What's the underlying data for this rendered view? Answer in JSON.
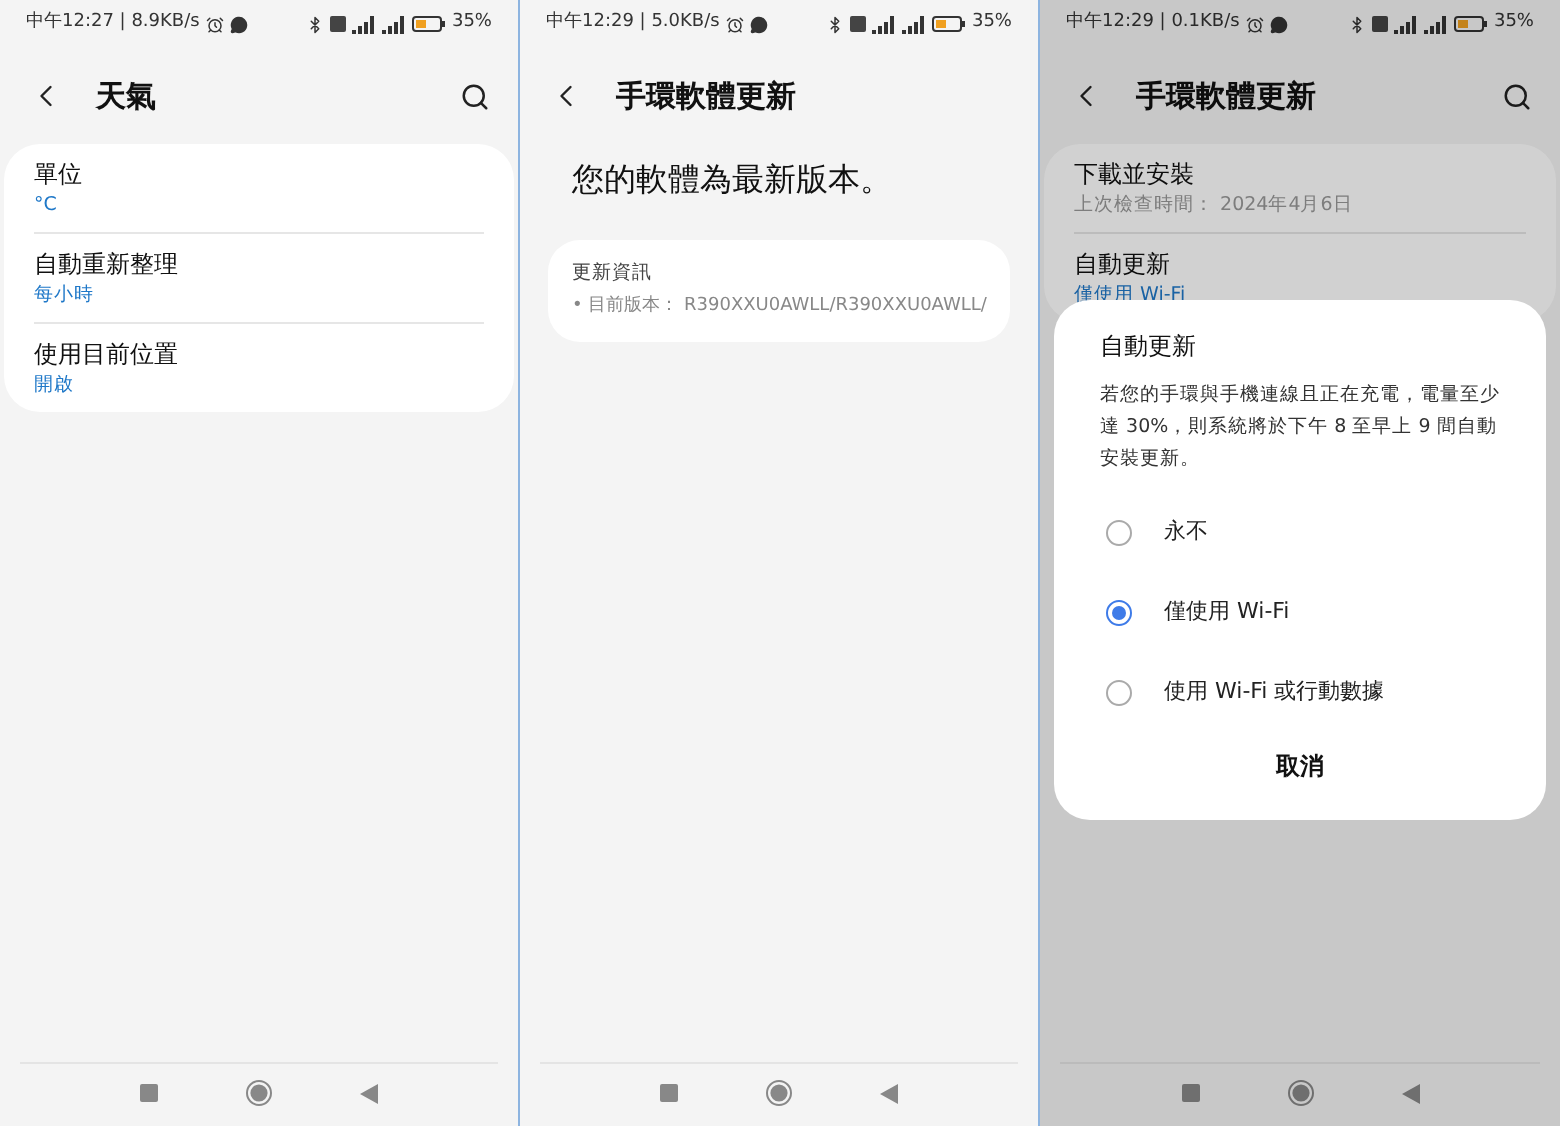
{
  "screens": [
    {
      "status": {
        "time": "中午12:27 | 8.9KB/s",
        "battery": "35%"
      },
      "header": {
        "title": "天氣",
        "search": true
      },
      "items": [
        {
          "label": "單位",
          "value": "°C",
          "highlight": true
        },
        {
          "label": "自動重新整理",
          "value": "每小時",
          "highlight": true
        },
        {
          "label": "使用目前位置",
          "value": "開啟",
          "highlight": true
        }
      ]
    },
    {
      "status": {
        "time": "中午12:29 | 5.0KB/s",
        "battery": "35%"
      },
      "header": {
        "title": "手環軟體更新",
        "search": false
      },
      "headline": "您的軟體為最新版本。",
      "info_card": {
        "title": "更新資訊",
        "line": "• 目前版本： R390XXU0AWLL/R390XXU0AWLL/"
      }
    },
    {
      "status": {
        "time": "中午12:29 | 0.1KB/s",
        "battery": "35%"
      },
      "header": {
        "title": "手環軟體更新",
        "search": true
      },
      "items": [
        {
          "label": "下載並安裝",
          "value": "上次檢查時間： 2024年4月6日",
          "highlight": false
        },
        {
          "label": "自動更新",
          "value": "僅使用 Wi-Fi",
          "highlight": true
        }
      ],
      "dialog": {
        "title": "自動更新",
        "body": "若您的手環與手機連線且正在充電，電量至少達 30%，則系統將於下午 8 至早上 9 間自動安裝更新。",
        "options": [
          {
            "label": "永不",
            "selected": false
          },
          {
            "label": "僅使用 Wi-Fi",
            "selected": true
          },
          {
            "label": "使用 Wi-Fi 或行動數據",
            "selected": false
          }
        ],
        "cancel": "取消"
      }
    }
  ]
}
